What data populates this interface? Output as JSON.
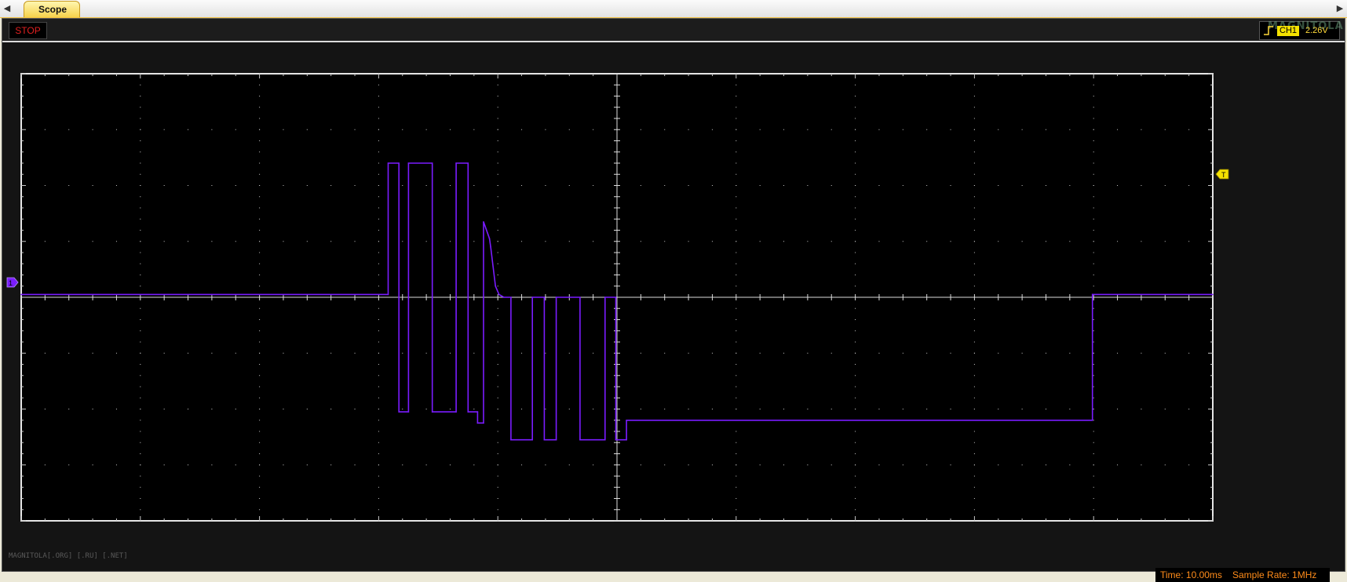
{
  "tabs": [
    {
      "label": "Scope",
      "active": true
    }
  ],
  "toolbar": {
    "stop_label": "STOP",
    "channel_label": "CH1",
    "trigger_level": "2.26V",
    "logo_text": "MAGNITOLA"
  },
  "markers": {
    "ground": "1",
    "trigger": "T"
  },
  "footer": {
    "watermark": "MAGNITOLA[.ORG] [.RU] [.NET]",
    "time_label": "Time: 10.00ms",
    "sample_rate_label": "Sample Rate: 1MHz"
  },
  "colors": {
    "trace": "#7a1cff",
    "grid": "#c8c8c8",
    "marker": "#f5e200",
    "readout": "#ff8c1a",
    "stop": "#e02020"
  },
  "chart_data": {
    "type": "line",
    "x_unit": "ms",
    "y_unit": "div",
    "xlim": [
      0,
      100
    ],
    "ylim": [
      -4,
      4
    ],
    "x_divisions": 10,
    "y_divisions": 8,
    "grid": true,
    "x": [
      0,
      30.8,
      30.8,
      31.7,
      31.7,
      32.5,
      32.5,
      34.5,
      34.5,
      36.5,
      36.5,
      37.5,
      37.5,
      38.3,
      38.3,
      38.8,
      38.8,
      39.3,
      39.4,
      39.8,
      40.1,
      40.5,
      41.1,
      41.1,
      42.9,
      42.9,
      43.9,
      43.9,
      44.9,
      44.9,
      46.9,
      46.9,
      49.0,
      49.0,
      49.9,
      49.9,
      50.8,
      50.8,
      89.9,
      89.9,
      100
    ],
    "y": [
      0.05,
      0.05,
      2.4,
      2.4,
      -2.05,
      -2.05,
      2.4,
      2.4,
      -2.05,
      -2.05,
      2.4,
      2.4,
      -2.05,
      -2.05,
      -2.25,
      -2.25,
      1.35,
      1.05,
      0.9,
      0.2,
      0.05,
      0.0,
      0.0,
      -2.55,
      -2.55,
      0.0,
      0.0,
      -2.55,
      -2.55,
      0.0,
      0.0,
      -2.55,
      -2.55,
      0.0,
      0.0,
      -2.55,
      -2.55,
      -2.2,
      -2.2,
      0.05,
      0.05
    ]
  }
}
